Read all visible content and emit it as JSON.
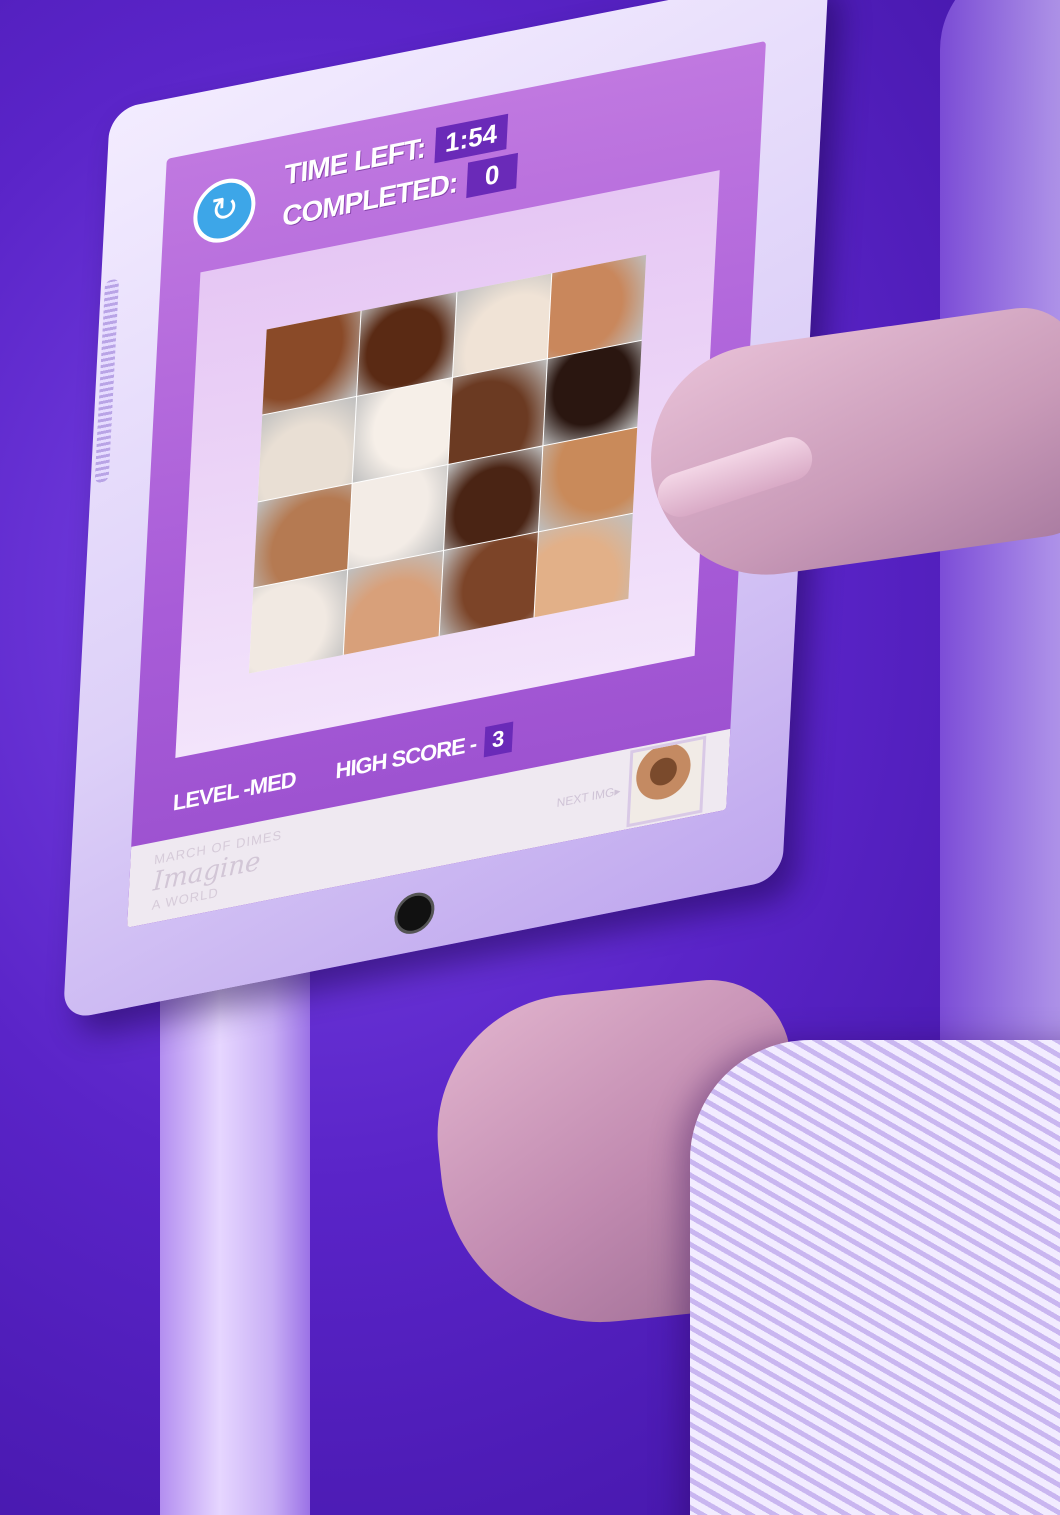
{
  "game": {
    "time_left_label": "TIME LEFT:",
    "time_left_value": "1:54",
    "completed_label": "COMPLETED:",
    "completed_value": "0",
    "level_text": "LEVEL -MED",
    "high_score_label": "HIGH SCORE -",
    "high_score_value": "3",
    "restart_icon": "restart-icon",
    "next_image_label": "NEXT IMG▸"
  },
  "banner": {
    "brand_small": "MARCH OF DIMES",
    "tagline_script": "Imagine",
    "tagline_rest": "A WORLD"
  },
  "puzzle": {
    "grid": "4x4",
    "tile_colors": [
      "#8a4a28",
      "#5a2a14",
      "#f0e3d6",
      "#c9875c",
      "#e9dfd4",
      "#f6efe8",
      "#6b3a22",
      "#2a1610",
      "#b57a52",
      "#f3ece6",
      "#4a2414",
      "#c98a5a",
      "#f1e9e2",
      "#d8a07a",
      "#7c4428",
      "#e2b088"
    ]
  },
  "colors": {
    "background": "#5a24c8",
    "screen": "#b066da",
    "stat_box": "#6a2ab8",
    "restart_button": "#3da6e8"
  }
}
